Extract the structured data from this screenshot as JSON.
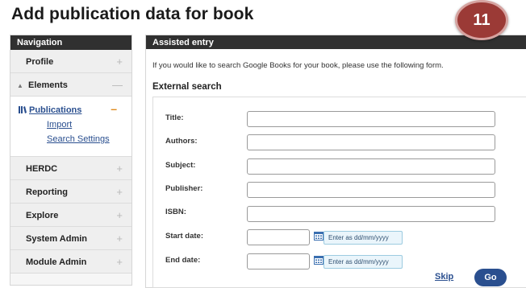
{
  "page": {
    "title": "Add publication data for book"
  },
  "sidebar": {
    "header": "Navigation",
    "items": [
      {
        "label": "Profile",
        "state": "collapsed"
      },
      {
        "label": "Elements",
        "state": "expanded"
      },
      {
        "label": "HERDC",
        "state": "collapsed"
      },
      {
        "label": "Reporting",
        "state": "collapsed"
      },
      {
        "label": "Explore",
        "state": "collapsed"
      },
      {
        "label": "System Admin",
        "state": "collapsed"
      },
      {
        "label": "Module Admin",
        "state": "collapsed"
      }
    ],
    "elements_subnav": {
      "active": "Publications",
      "links": [
        "Import",
        "Search Settings"
      ]
    },
    "icons": {
      "expand": "plus-icon",
      "collapse": "minus-icon",
      "expanded_marker": "arrow-icon",
      "publications": "books-icon"
    }
  },
  "main": {
    "header": "Assisted entry",
    "intro": "If you would like to search Google Books for your book, please use the following form.",
    "section_title": "External search",
    "fields": [
      {
        "label": "Title:",
        "value": ""
      },
      {
        "label": "Authors:",
        "value": ""
      },
      {
        "label": "Subject:",
        "value": ""
      },
      {
        "label": "Publisher:",
        "value": ""
      },
      {
        "label": "ISBN:",
        "value": ""
      }
    ],
    "date_fields": [
      {
        "label": "Start date:",
        "value": "",
        "hint": "Enter as dd/mm/yyyy"
      },
      {
        "label": "End date:",
        "value": "",
        "hint": "Enter as dd/mm/yyyy"
      }
    ],
    "skip_label": "Skip",
    "go_label": "Go"
  },
  "badge": {
    "number": "11",
    "color": "#9b3a36"
  },
  "colors": {
    "header_bg": "#303030",
    "link": "#2a4f8f",
    "accent": "#e08a1e"
  }
}
